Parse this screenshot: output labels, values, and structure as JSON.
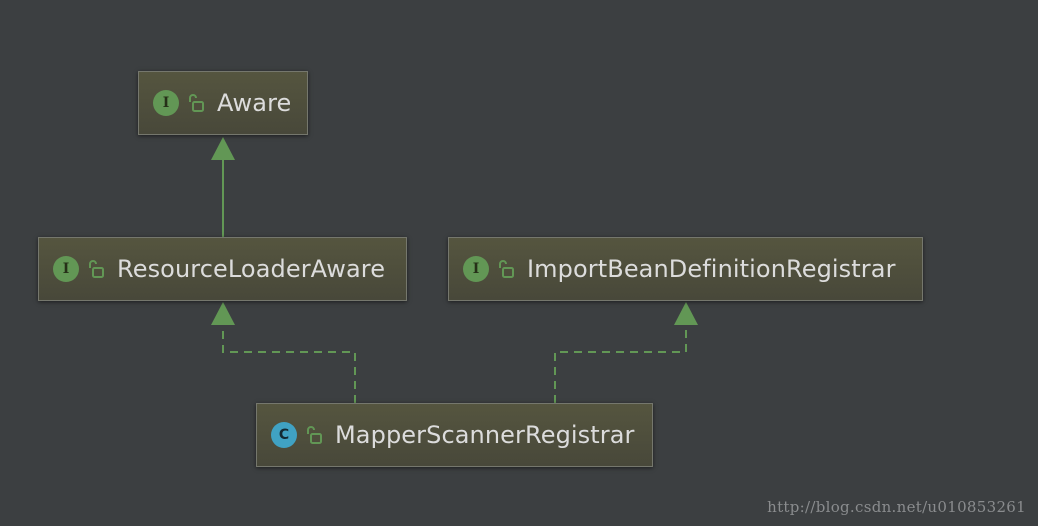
{
  "nodes": {
    "aware": {
      "badge": "I",
      "kind": "interface",
      "label": "Aware",
      "icon": "unlock-icon"
    },
    "resource_loader_aware": {
      "badge": "I",
      "kind": "interface",
      "label": "ResourceLoaderAware",
      "icon": "unlock-icon"
    },
    "import_bean_definition_registrar": {
      "badge": "I",
      "kind": "interface",
      "label": "ImportBeanDefinitionRegistrar",
      "icon": "unlock-icon"
    },
    "mapper_scanner_registrar": {
      "badge": "C",
      "kind": "class",
      "label": "MapperScannerRegistrar",
      "icon": "unlock-icon"
    }
  },
  "edges": [
    {
      "from": "resource_loader_aware",
      "to": "aware",
      "relation": "extends",
      "style": "solid"
    },
    {
      "from": "mapper_scanner_registrar",
      "to": "resource_loader_aware",
      "relation": "implements",
      "style": "dashed"
    },
    {
      "from": "mapper_scanner_registrar",
      "to": "import_bean_definition_registrar",
      "relation": "implements",
      "style": "dashed"
    }
  ],
  "colors": {
    "background": "#3c3f41",
    "edge": "#629755",
    "interface_badge": "#629755",
    "class_badge": "#40a2c3",
    "text": "#dcdcdc"
  },
  "watermark": "http://blog.csdn.net/u010853261"
}
